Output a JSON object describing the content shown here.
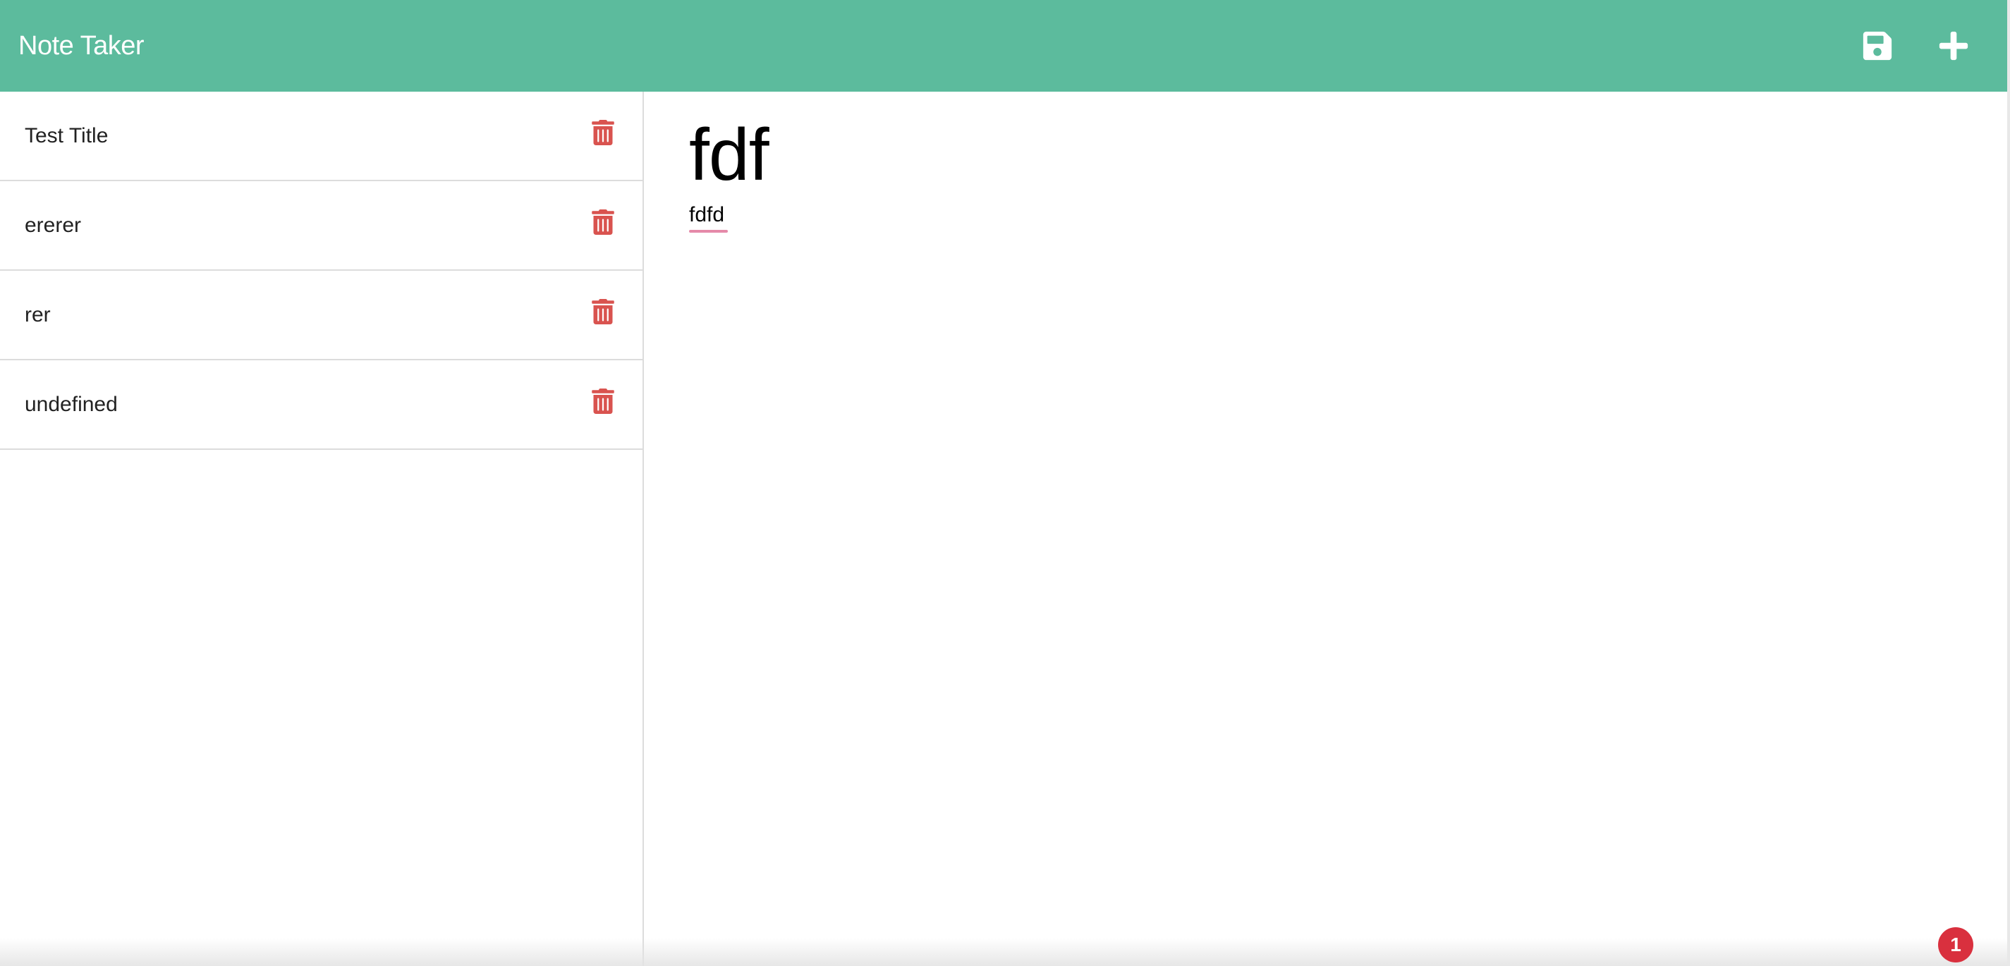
{
  "navbar": {
    "brand": "Note Taker",
    "save_icon": "floppy-disk-icon",
    "new_icon": "plus-icon",
    "icon_color": "#ffffff",
    "background": "#5cbb9d"
  },
  "sidebar": {
    "notes": [
      {
        "title": "Test Title"
      },
      {
        "title": "ererer"
      },
      {
        "title": "rer"
      },
      {
        "title": "undefined"
      }
    ],
    "delete_icon": "trash-icon",
    "delete_color": "#d9534f"
  },
  "editor": {
    "title_value": "fdf",
    "text_value": "fdfd"
  },
  "notification": {
    "count": "1",
    "color": "#d9303e"
  }
}
